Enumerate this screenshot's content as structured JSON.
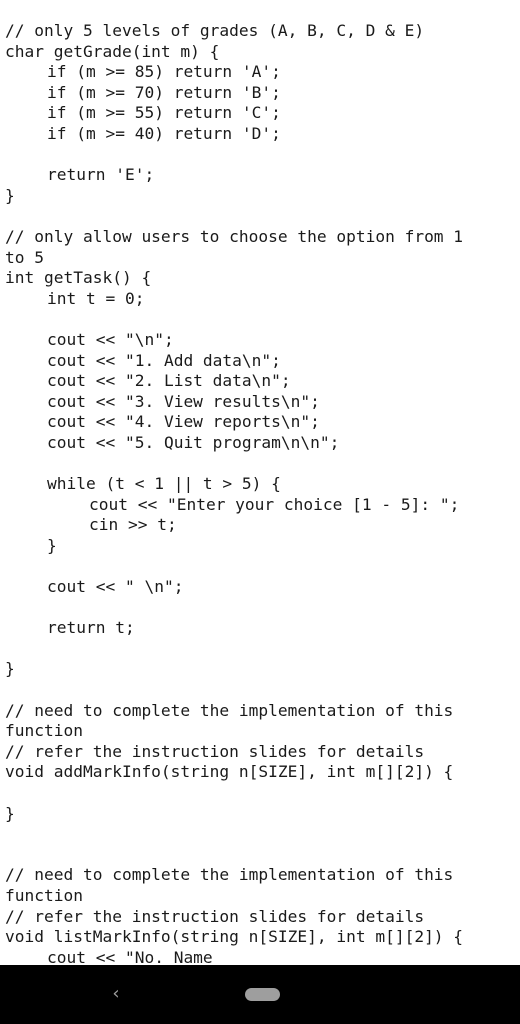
{
  "code": {
    "lines": [
      {
        "text": "// only 5 levels of grades (A, B, C, D & E)",
        "indent": 0
      },
      {
        "text": "char getGrade(int m) {",
        "indent": 0
      },
      {
        "text": "if (m >= 85) return 'A';",
        "indent": 1
      },
      {
        "text": "if (m >= 70) return 'B';",
        "indent": 1
      },
      {
        "text": "if (m >= 55) return 'C';",
        "indent": 1
      },
      {
        "text": "if (m >= 40) return 'D';",
        "indent": 1
      },
      {
        "text": "",
        "indent": 0
      },
      {
        "text": "return 'E';",
        "indent": 1
      },
      {
        "text": "}",
        "indent": 0
      },
      {
        "text": "",
        "indent": 0
      },
      {
        "text": "// only allow users to choose the option from 1",
        "indent": 0
      },
      {
        "text": "to 5",
        "indent": 0
      },
      {
        "text": "int getTask() {",
        "indent": 0
      },
      {
        "text": "int t = 0;",
        "indent": 1
      },
      {
        "text": "",
        "indent": 0
      },
      {
        "text": "cout << \"\\n\";",
        "indent": 1
      },
      {
        "text": "cout << \"1. Add data\\n\";",
        "indent": 1
      },
      {
        "text": "cout << \"2. List data\\n\";",
        "indent": 1
      },
      {
        "text": "cout << \"3. View results\\n\";",
        "indent": 1
      },
      {
        "text": "cout << \"4. View reports\\n\";",
        "indent": 1
      },
      {
        "text": "cout << \"5. Quit program\\n\\n\";",
        "indent": 1
      },
      {
        "text": "",
        "indent": 0
      },
      {
        "text": "while (t < 1 || t > 5) {",
        "indent": 1
      },
      {
        "text": "cout << \"Enter your choice [1 - 5]: \";",
        "indent": 2
      },
      {
        "text": "cin >> t;",
        "indent": 2
      },
      {
        "text": "}",
        "indent": 1
      },
      {
        "text": "",
        "indent": 0
      },
      {
        "text": "cout << \" \\n\";",
        "indent": 1
      },
      {
        "text": "",
        "indent": 0
      },
      {
        "text": "return t;",
        "indent": 1
      },
      {
        "text": "",
        "indent": 0
      },
      {
        "text": "}",
        "indent": 0
      },
      {
        "text": "",
        "indent": 0
      },
      {
        "text": "// need to complete the implementation of this",
        "indent": 0
      },
      {
        "text": "function",
        "indent": 0
      },
      {
        "text": "// refer the instruction slides for details",
        "indent": 0
      },
      {
        "text": "void addMarkInfo(string n[SIZE], int m[][2]) {",
        "indent": 0
      },
      {
        "text": "",
        "indent": 0
      },
      {
        "text": "}",
        "indent": 0
      },
      {
        "text": "",
        "indent": 0
      },
      {
        "text": "",
        "indent": 0
      },
      {
        "text": "// need to complete the implementation of this",
        "indent": 0
      },
      {
        "text": "function",
        "indent": 0
      },
      {
        "text": "// refer the instruction slides for details",
        "indent": 0
      },
      {
        "text": "void listMarkInfo(string n[SIZE], int m[][2]) {",
        "indent": 0
      },
      {
        "text": "cout << \"No. Name",
        "indent": 1
      }
    ]
  },
  "navbar": {
    "back_icon": "chevron-left-icon",
    "back_glyph": "‹",
    "home_icon": "home-pill-icon"
  }
}
